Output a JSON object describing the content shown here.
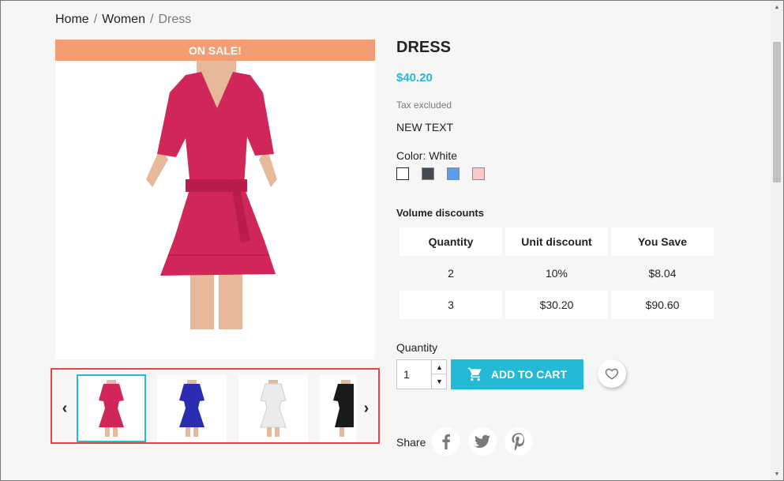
{
  "breadcrumb": {
    "items": [
      "Home",
      "Women",
      "Dress"
    ],
    "separator": "/"
  },
  "product": {
    "flag": "ON SALE!",
    "name": "DRESS",
    "price": "$40.20",
    "tax_note": "Tax excluded",
    "extra_text": "NEW TEXT",
    "color_label": "Color: White",
    "colors": [
      {
        "name": "White",
        "hex": "#ffffff",
        "selected": true
      },
      {
        "name": "Grey",
        "hex": "#434a54"
      },
      {
        "name": "Blue",
        "hex": "#5d9cec"
      },
      {
        "name": "Pink",
        "hex": "#fcc8c8"
      }
    ],
    "image_color": "#d0265a"
  },
  "thumbnails": {
    "prev_icon": "chevron-left-icon",
    "next_icon": "chevron-right-icon",
    "items": [
      {
        "name": "red-dress",
        "color": "#d0265a",
        "selected": true
      },
      {
        "name": "blue-dress",
        "color": "#2a2db0"
      },
      {
        "name": "white-dress",
        "color": "#ececec"
      },
      {
        "name": "black-dress",
        "color": "#1a1a1a"
      }
    ]
  },
  "volume_discounts": {
    "title": "Volume discounts",
    "headers": [
      "Quantity",
      "Unit discount",
      "You Save"
    ],
    "rows": [
      [
        "2",
        "10%",
        "$8.04"
      ],
      [
        "3",
        "$30.20",
        "$90.60"
      ]
    ]
  },
  "cart": {
    "quantity_label": "Quantity",
    "quantity_value": "1",
    "add_to_cart_label": "ADD TO CART",
    "cart_icon": "shopping-cart-icon",
    "wishlist_icon": "heart-icon"
  },
  "share": {
    "label": "Share",
    "networks": [
      "facebook-icon",
      "twitter-icon",
      "pinterest-icon"
    ]
  }
}
